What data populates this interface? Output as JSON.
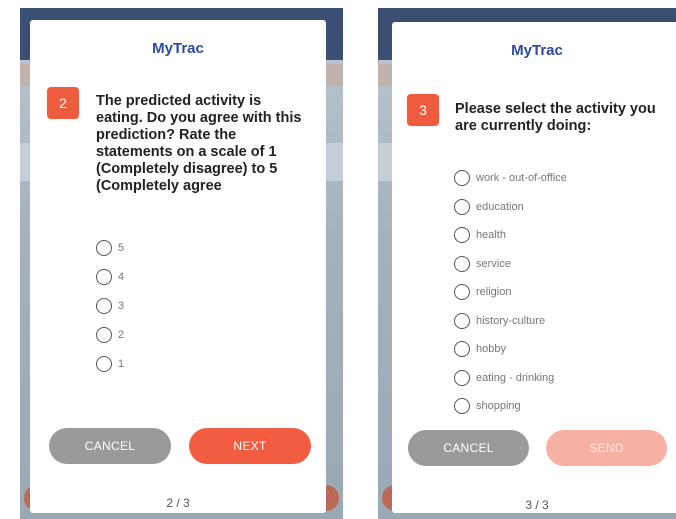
{
  "screens": [
    {
      "app_title": "MyTrac",
      "question_number": "2",
      "question_text": "The predicted activity is eating. Do you agree with this prediction? Rate the statements on a scale of 1 (Completely disagree) to 5 (Completely agree",
      "options": [
        "5",
        "4",
        "3",
        "2",
        "1"
      ],
      "cancel_label": "CANCEL",
      "primary_label": "NEXT",
      "pager": "2 / 3"
    },
    {
      "app_title": "MyTrac",
      "question_number": "3",
      "question_text": "Please select the activity you are currently doing:",
      "options": [
        "work - out-of-office",
        "education",
        "health",
        "service",
        "religion",
        "history-culture",
        "hobby",
        "eating - drinking",
        "shopping"
      ],
      "cancel_label": "CANCEL",
      "primary_label": "SEND",
      "pager": "3 / 3"
    }
  ],
  "colors": {
    "accent": "#f25c40",
    "accent_disabled": "#f7b1a4",
    "title": "#2c4aa0",
    "cancel": "#9a9a9a"
  }
}
